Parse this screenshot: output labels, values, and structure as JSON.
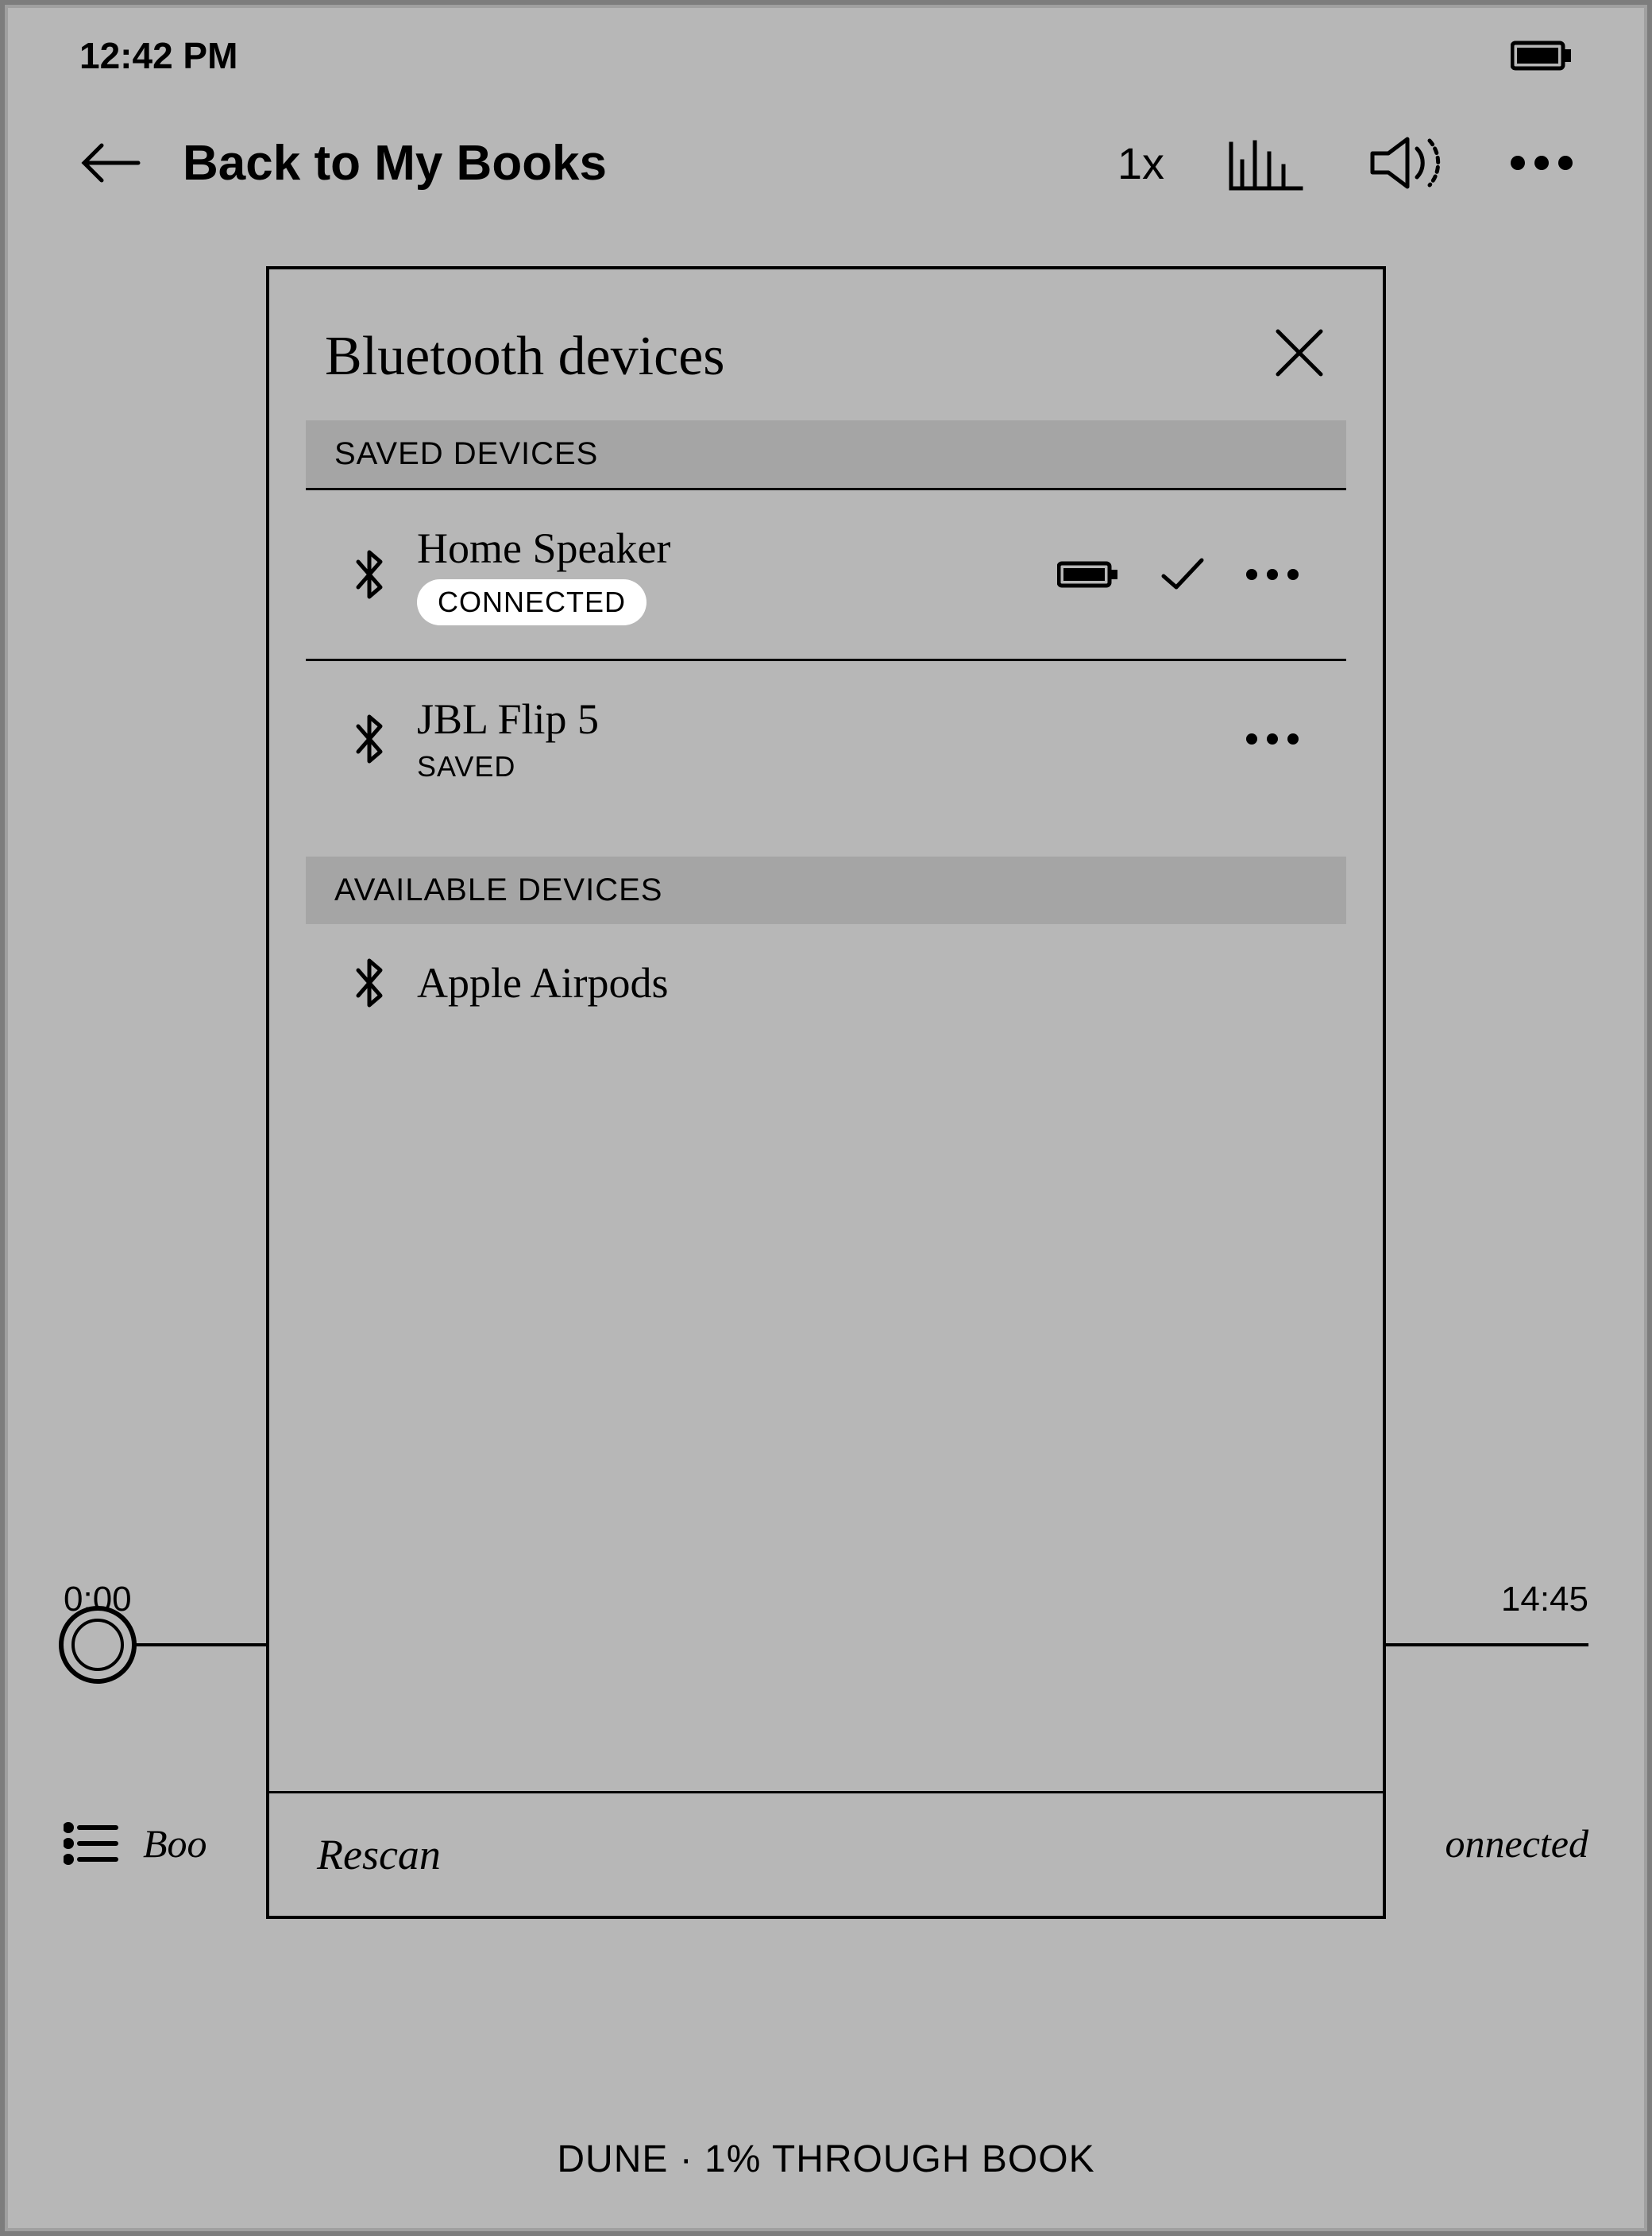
{
  "status": {
    "time": "12:42 PM"
  },
  "toolbar": {
    "back_label": "Back to My Books",
    "speed_label": "1x"
  },
  "player": {
    "elapsed": "0:00",
    "remaining": "14:45"
  },
  "bottom": {
    "left_text": "Boo",
    "right_text": "onnected"
  },
  "caption": "DUNE · 1% THROUGH BOOK",
  "modal": {
    "title": "Bluetooth devices",
    "sections": {
      "saved_header": "SAVED DEVICES",
      "available_header": "AVAILABLE DEVICES"
    },
    "saved": [
      {
        "name": "Home Speaker",
        "status": "CONNECTED",
        "connected": true
      },
      {
        "name": "JBL Flip 5",
        "status": "SAVED",
        "connected": false
      }
    ],
    "available": [
      {
        "name": "Apple Airpods"
      }
    ],
    "footer_action": "Rescan"
  }
}
